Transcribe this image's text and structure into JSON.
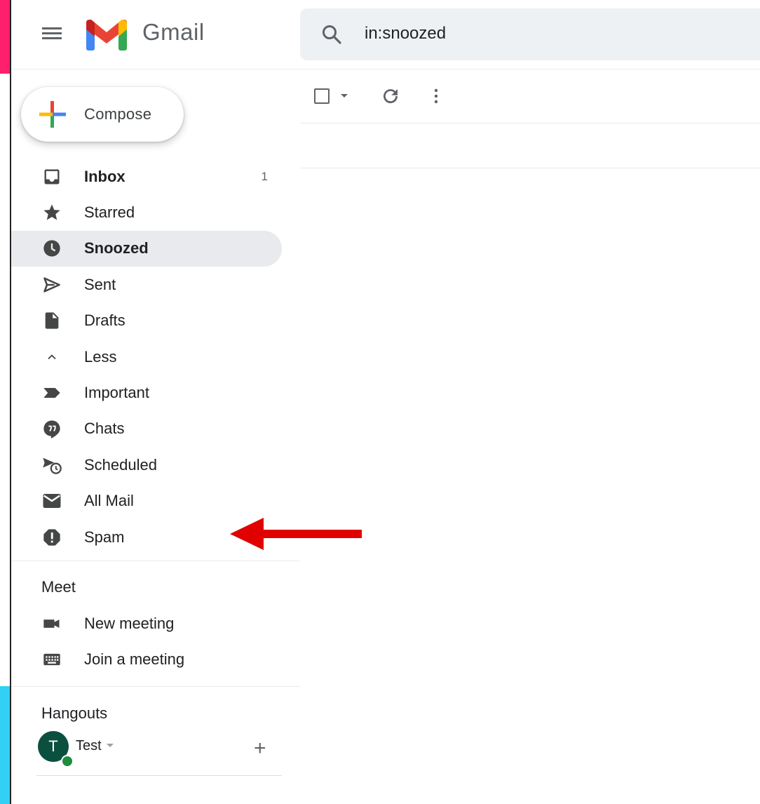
{
  "app": {
    "name": "Gmail"
  },
  "search": {
    "query": "in:snoozed"
  },
  "compose": {
    "label": "Compose"
  },
  "sidebar": {
    "items": [
      {
        "label": "Inbox",
        "count": "1",
        "icon": "inbox-icon",
        "bold": true
      },
      {
        "label": "Starred",
        "count": "",
        "icon": "star-icon"
      },
      {
        "label": "Snoozed",
        "count": "",
        "icon": "clock-icon",
        "bold": true,
        "active": true
      },
      {
        "label": "Sent",
        "count": "",
        "icon": "send-icon"
      },
      {
        "label": "Drafts",
        "count": "",
        "icon": "draft-icon"
      },
      {
        "label": "Less",
        "count": "",
        "icon": "chevron-up-icon"
      },
      {
        "label": "Important",
        "count": "",
        "icon": "important-icon"
      },
      {
        "label": "Chats",
        "count": "",
        "icon": "chat-icon"
      },
      {
        "label": "Scheduled",
        "count": "",
        "icon": "scheduled-icon"
      },
      {
        "label": "All Mail",
        "count": "",
        "icon": "mail-icon"
      },
      {
        "label": "Spam",
        "count": "",
        "icon": "spam-icon"
      }
    ]
  },
  "meet": {
    "title": "Meet",
    "items": [
      {
        "label": "New meeting",
        "icon": "video-camera-icon"
      },
      {
        "label": "Join a meeting",
        "icon": "keyboard-icon"
      }
    ]
  },
  "hangouts": {
    "title": "Hangouts",
    "user": {
      "initial": "T",
      "name": "Test"
    }
  },
  "colors": {
    "accent_red": "#ea4335",
    "arrow": "#e00000",
    "active_bg": "#e8eaed"
  }
}
